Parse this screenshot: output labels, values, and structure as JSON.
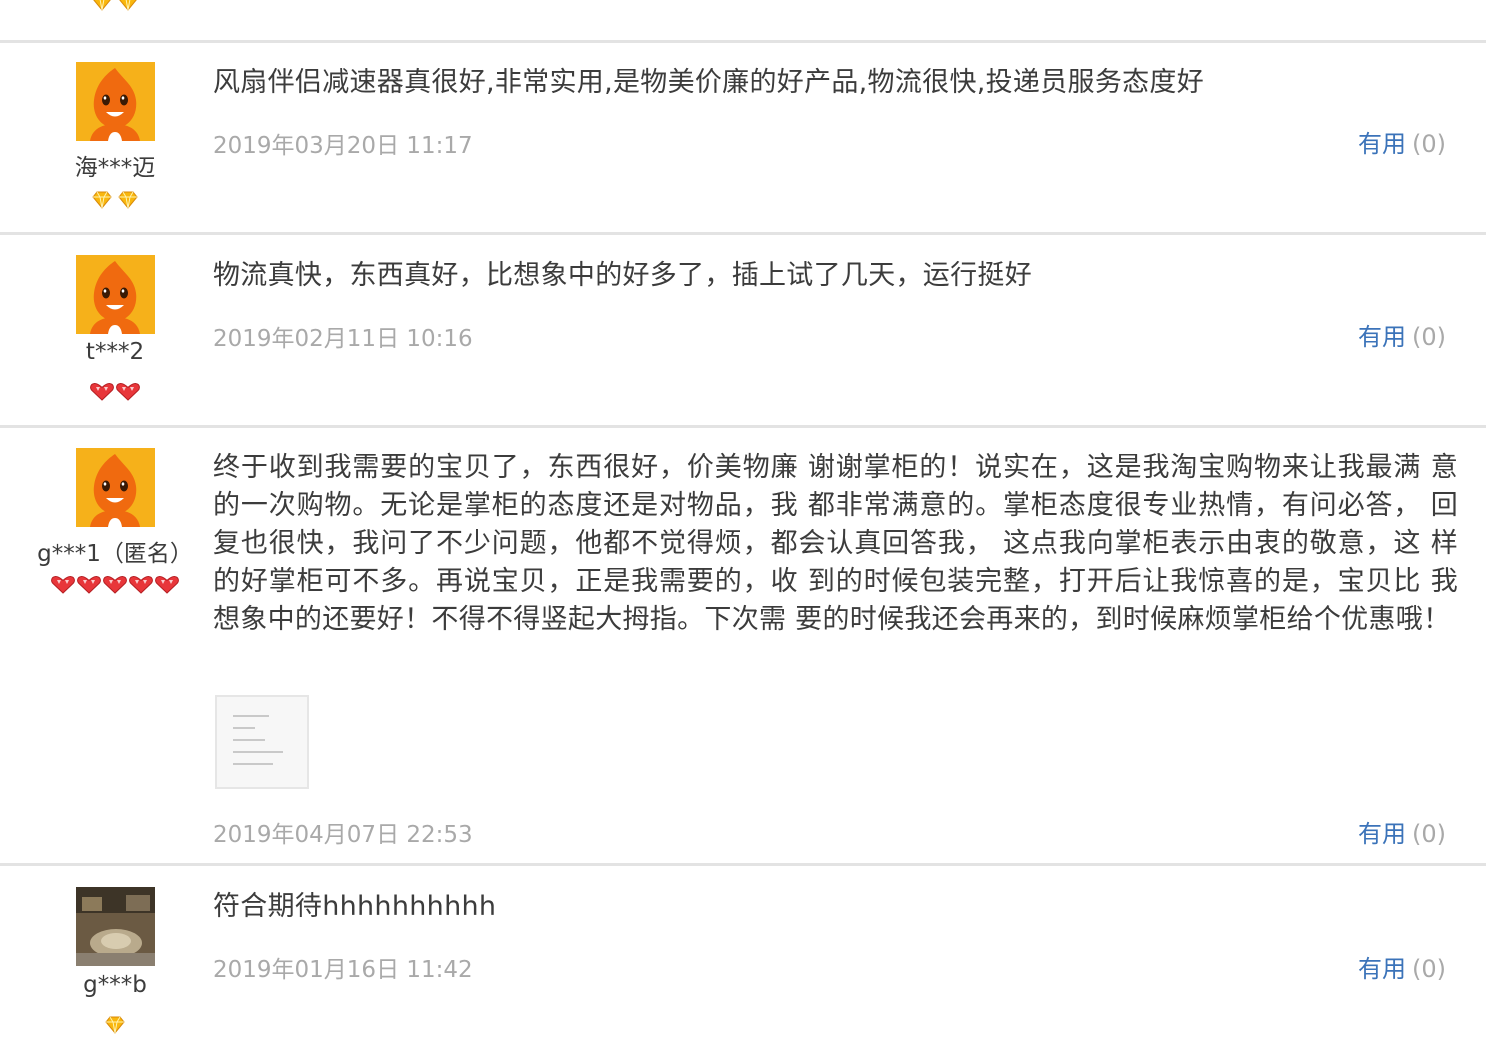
{
  "reviews": [
    {
      "username": "海***迈",
      "badge_type": "gold-diamond",
      "badge_count": 2,
      "text": "风扇伴侣减速器真很好,非常实用,是物美价廉的好产品,物流很快,投递员服务态度好",
      "date": "2019年03月20日 11:17",
      "useful_label": "有用",
      "useful_count": "(0)"
    },
    {
      "username": "t***2",
      "badge_type": "red-heart",
      "badge_count": 2,
      "text": "物流真快，东西真好，比想象中的好多了，插上试了几天，运行挺好",
      "date": "2019年02月11日 10:16",
      "useful_label": "有用",
      "useful_count": "(0)"
    },
    {
      "username": "g***1（匿名）",
      "badge_type": "red-heart",
      "badge_count": 5,
      "text": "终于收到我需要的宝贝了，东西很好，价美物廉 谢谢掌柜的！说实在，这是我淘宝购物来让我最满 意的一次购物。无论是掌柜的态度还是对物品，我 都非常满意的。掌柜态度很专业热情，有问必答， 回复也很快，我问了不少问题，他都不觉得烦，都会认真回答我， 这点我向掌柜表示由衷的敬意，这 样的好掌柜可不多。再说宝贝，正是我需要的，收 到的时候包装完整，打开后让我惊喜的是，宝贝比 我想象中的还要好！不得不得竖起大拇指。下次需 要的时候我还会再来的，到时候麻烦掌柜给个优惠哦！",
      "has_image": true,
      "date": "2019年04月07日 22:53",
      "useful_label": "有用",
      "useful_count": "(0)"
    },
    {
      "username": "g***b",
      "badge_type": "gold-diamond",
      "badge_count": 1,
      "text": "符合期待hhhhhhhhhh",
      "date": "2019年01月16日 11:42",
      "useful_label": "有用",
      "useful_count": "(0)"
    }
  ],
  "colors": {
    "text": "#3c3c3c",
    "date": "#a9a9a9",
    "useful_link": "#3b73b9",
    "divider": "#e3e3e3",
    "avatar_bg": "#f6b11a",
    "doll_orange": "#f06a0f",
    "heart_red": "#e8363a",
    "diamond_gold": "#f9b70d"
  }
}
